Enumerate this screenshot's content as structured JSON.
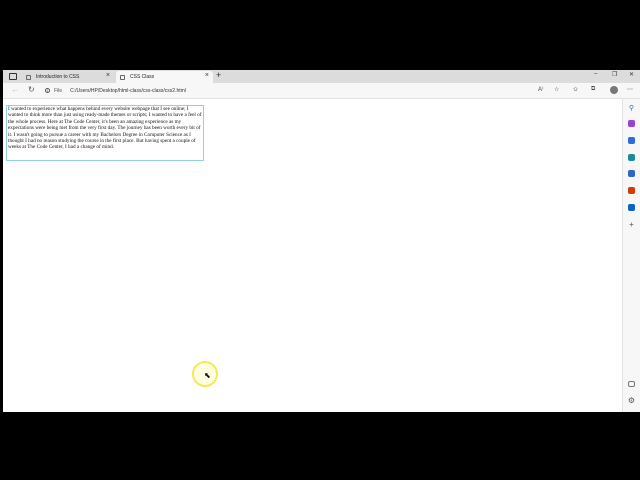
{
  "tabs": [
    {
      "label": "Introduction to CSS",
      "active": false
    },
    {
      "label": "CSS Class",
      "active": true
    }
  ],
  "address": {
    "scheme_label": "File",
    "url": "C:/Users/HP/Desktop/html-class/css-class/css2.html"
  },
  "content": {
    "paragraph": "I wanted to experience what happens behind every website webpage that I see online; I wanted to think more than just using ready-made themes or scripts; I wanted to have a feel of the whole process. Here at The Code Center, it's been an amazing experience as my expectations were being met from the very first day. The journey has been worth every bit of it. I wasn't going to pursue a career with my Bachelors Degree in Computer Science as I thought I had no reason studying the course in the first place. But having spent a couple of weeks at The Code Center, I had a change of mind."
  },
  "colors": {
    "paragraph_border": "#8fd3e0",
    "cursor_highlight": "#f2ea5a"
  }
}
